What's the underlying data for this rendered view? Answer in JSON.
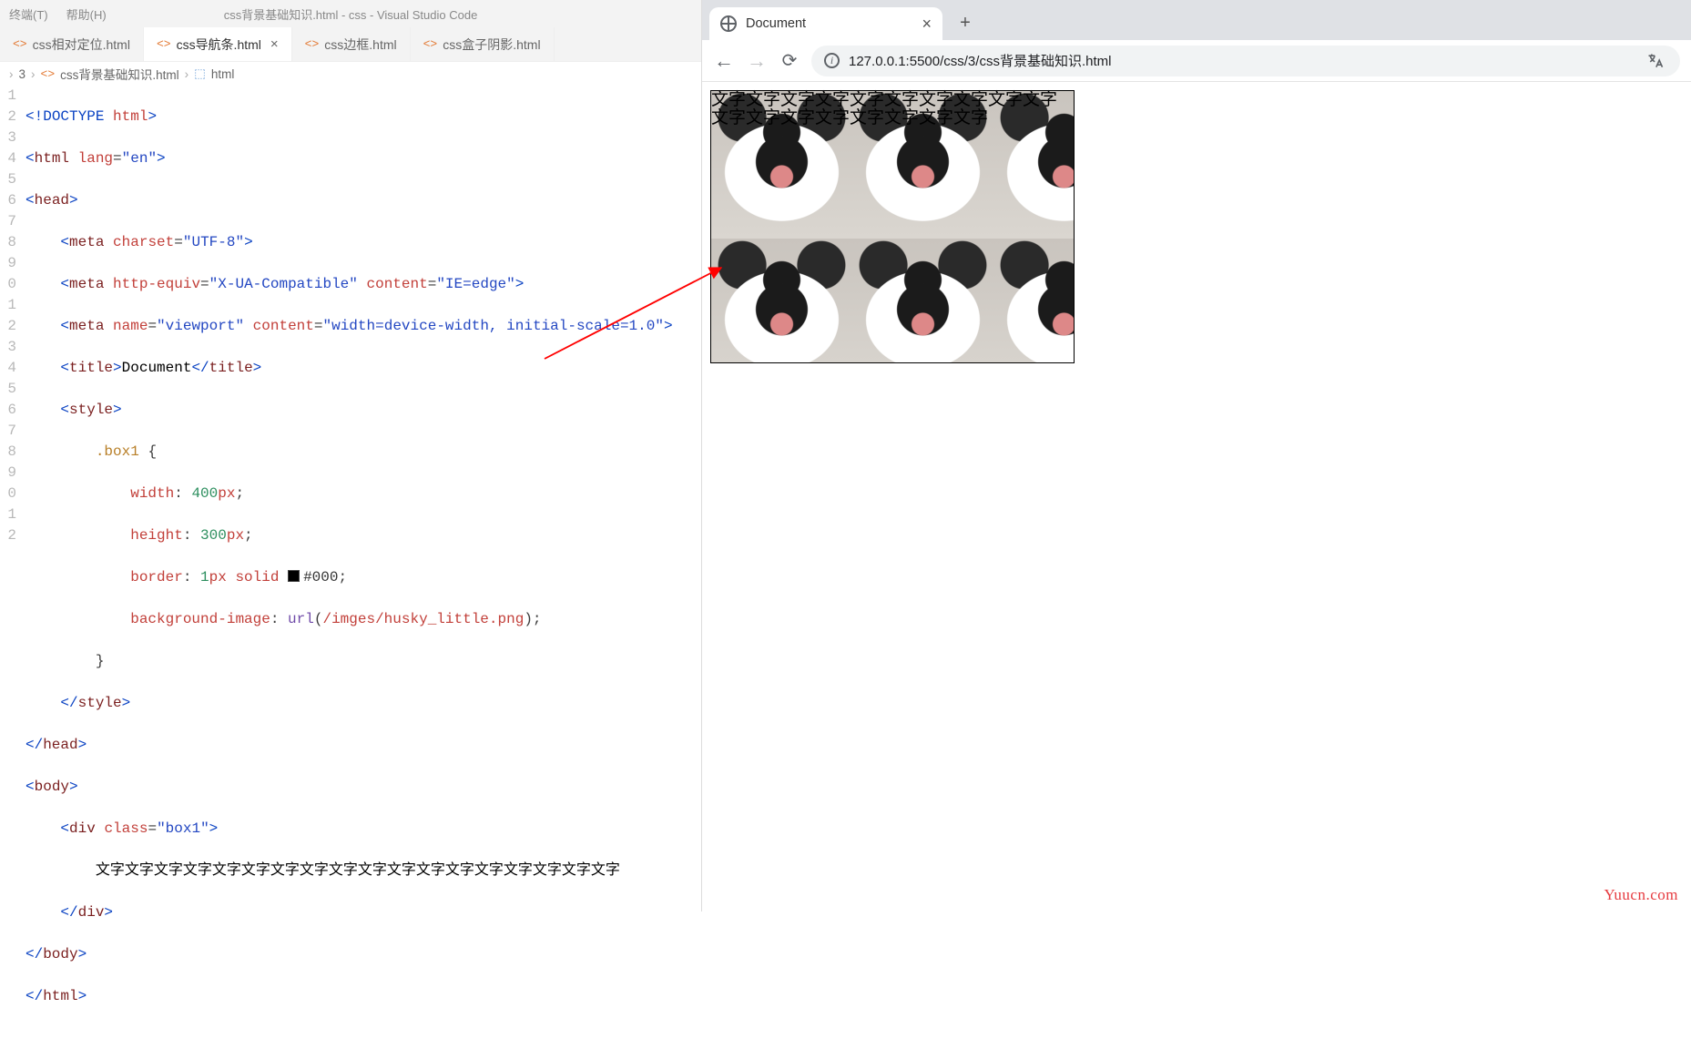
{
  "vscode": {
    "menubar": {
      "terminal": "终端(T)",
      "help": "帮助(H)"
    },
    "title": "css背景基础知识.html - css - Visual Studio Code",
    "tabs": [
      {
        "label": "css相对定位.html",
        "active": false,
        "close": false
      },
      {
        "label": "css导航条.html",
        "active": true,
        "close": true
      },
      {
        "label": "css边框.html",
        "active": false,
        "close": false
      },
      {
        "label": "css盒子阴影.html",
        "active": false,
        "close": false
      }
    ],
    "breadcrumb": {
      "seg1": "3",
      "seg2": "css背景基础知识.html",
      "seg3": "html"
    },
    "code": {
      "l1": {
        "n": "1",
        "doctype_kw": "!DOCTYPE",
        "doctype_attr": "html"
      },
      "l2": {
        "n": "2",
        "tag": "html",
        "attr": "lang",
        "val": "\"en\""
      },
      "l3": {
        "n": "3",
        "tag": "head"
      },
      "l4": {
        "n": "4",
        "tag": "meta",
        "attr": "charset",
        "val": "\"UTF-8\""
      },
      "l5": {
        "n": "5",
        "tag": "meta",
        "a1": "http-equiv",
        "v1": "\"X-UA-Compatible\"",
        "a2": "content",
        "v2": "\"IE=edge\""
      },
      "l6": {
        "n": "6",
        "tag": "meta",
        "a1": "name",
        "v1": "\"viewport\"",
        "a2": "content",
        "v2": "\"width=device-width, initial-scale=1.0\""
      },
      "l7": {
        "n": "7",
        "tag": "title",
        "text": "Document"
      },
      "l8": {
        "n": "8",
        "tag": "style"
      },
      "l9": {
        "n": "9",
        "selector": ".box1"
      },
      "l10": {
        "n": "0",
        "prop": "width",
        "num": "400",
        "unit": "px"
      },
      "l11": {
        "n": "1",
        "prop": "height",
        "num": "300",
        "unit": "px"
      },
      "l12": {
        "n": "2",
        "prop": "border",
        "num": "1",
        "unit": "px",
        "kw": "solid",
        "color": "#000"
      },
      "l13": {
        "n": "3",
        "prop": "background-image",
        "fn": "url",
        "arg": "/imges/husky_little.png"
      },
      "l14": {
        "n": "4"
      },
      "l15": {
        "n": "5",
        "tag": "style"
      },
      "l16": {
        "n": "6",
        "tag": "head"
      },
      "l17": {
        "n": "7",
        "tag": "body"
      },
      "l18": {
        "n": "8",
        "tag": "div",
        "attr": "class",
        "val": "\"box1\""
      },
      "l19": {
        "n": "9",
        "text": "文字文字文字文字文字文字文字文字文字文字文字文字文字文字文字文字文字文字"
      },
      "l20": {
        "n": "0",
        "tag": "div"
      },
      "l21": {
        "n": "1",
        "tag": "body"
      },
      "l22": {
        "n": "2",
        "tag": "html"
      }
    }
  },
  "chrome": {
    "tab_title": "Document",
    "url": "127.0.0.1:5500/css/3/css背景基础知识.html",
    "box_text": "文字文字文字文字文字文字文字文字文字文字文字文字文字文字文字文字文字文字"
  },
  "watermark": "Yuucn.com"
}
